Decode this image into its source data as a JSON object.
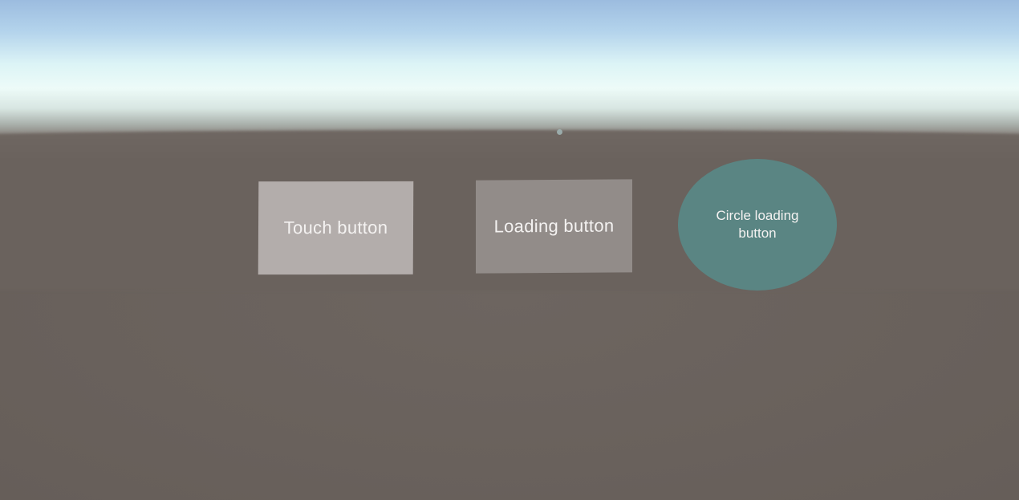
{
  "scene": {
    "colors": {
      "sky_top": "#9cbcdf",
      "horizon_glow": "#edfbf8",
      "ground": "#6a625d",
      "reticle": "#9fb3b3"
    }
  },
  "buttons": {
    "touch": {
      "label": "Touch button",
      "color": "#b3adab"
    },
    "loading": {
      "label": "Loading button",
      "color": "#928c89"
    },
    "circle_loading": {
      "label": "Circle loading button",
      "color": "#5a8583"
    }
  }
}
